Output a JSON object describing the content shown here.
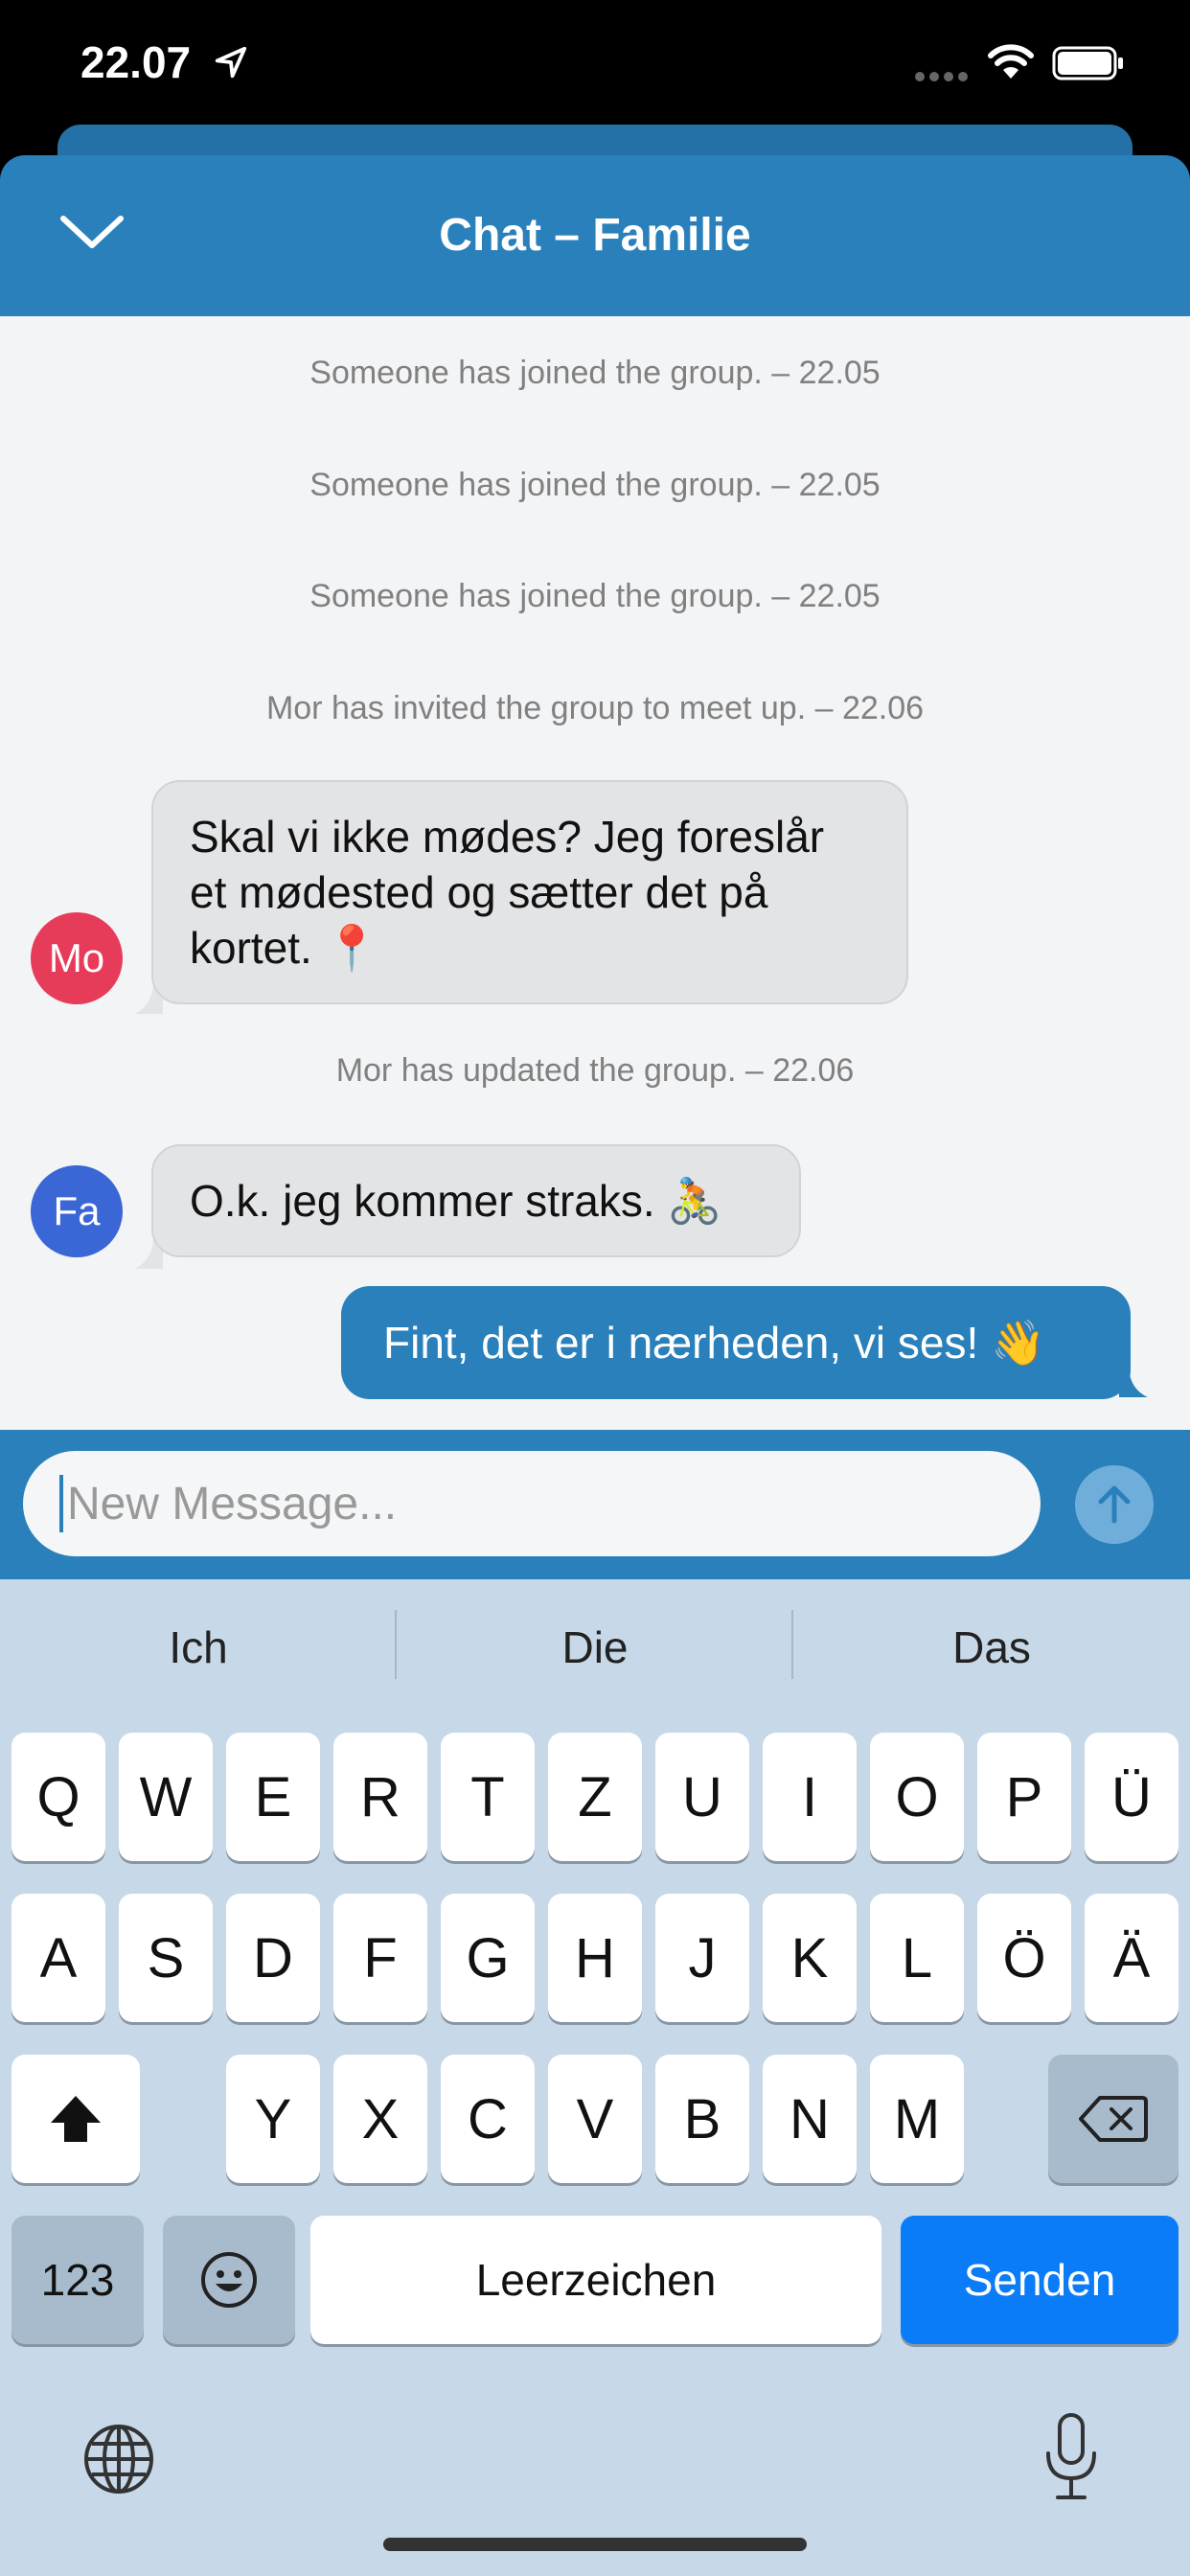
{
  "status_bar": {
    "time": "22.07"
  },
  "header": {
    "title": "Chat – Familie"
  },
  "chat": {
    "system_messages": [
      "Someone has joined the group. – 22.05",
      "Someone has joined the group. – 22.05",
      "Someone has joined the group. – 22.05",
      "Mor has invited the group to meet up. – 22.06",
      "Mor has updated the group. – 22.06"
    ],
    "messages": [
      {
        "avatar": "Mo",
        "text": "Skal vi ikke mødes? Jeg foreslår et mødested og sætter det på kortet. 📍",
        "avatar_color": "#e63c5a"
      },
      {
        "avatar": "Fa",
        "text": "O.k. jeg kommer straks. 🚴",
        "avatar_color": "#3a66d6"
      },
      {
        "text": "Fint, det er i nærheden, vi ses! 👋"
      }
    ]
  },
  "composer": {
    "placeholder": "New Message..."
  },
  "keyboard": {
    "suggestions": [
      "Ich",
      "Die",
      "Das"
    ],
    "row1": [
      "Q",
      "W",
      "E",
      "R",
      "T",
      "Z",
      "U",
      "I",
      "O",
      "P",
      "Ü"
    ],
    "row2": [
      "A",
      "S",
      "D",
      "F",
      "G",
      "H",
      "J",
      "K",
      "L",
      "Ö",
      "Ä"
    ],
    "row3": [
      "Y",
      "X",
      "C",
      "V",
      "B",
      "N",
      "M"
    ],
    "numbers_key": "123",
    "space_key": "Leerzeichen",
    "return_key": "Senden"
  },
  "colors": {
    "accent": "#2a80bb",
    "return_key": "#0a7cf8"
  }
}
